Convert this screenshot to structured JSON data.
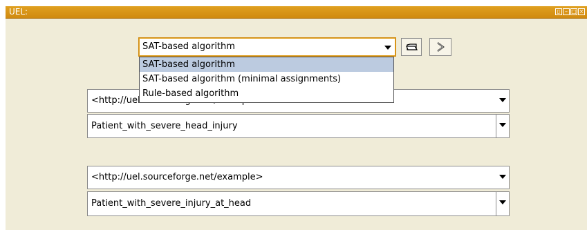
{
  "window": {
    "title": "UEL:"
  },
  "algorithm_select": {
    "selected": "SAT-based algorithm",
    "options": [
      "SAT-based algorithm",
      "SAT-based algorithm (minimal assignments)",
      "Rule-based algorithm"
    ]
  },
  "toolbar": {
    "open_icon": "folder-icon",
    "run_icon": "chevron-right-icon"
  },
  "group1": {
    "ontology": "<http://uel.sourceforge.net/example>",
    "concept": "Patient_with_severe_head_injury"
  },
  "group2": {
    "ontology": "<http://uel.sourceforge.net/example>",
    "concept": "Patient_with_severe_injury_at_head"
  },
  "colors": {
    "title_bar": "#d99418",
    "panel_bg": "#f0ecd8",
    "selection": "#bccbe0"
  }
}
